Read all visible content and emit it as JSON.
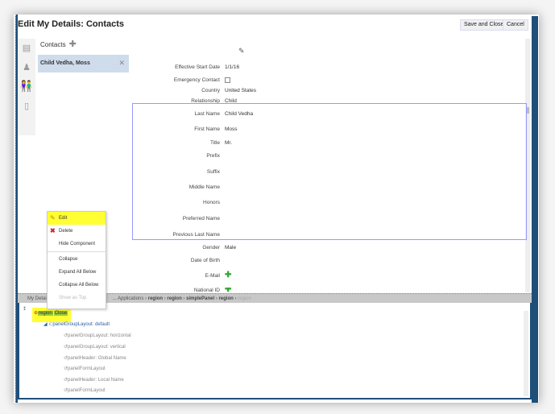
{
  "header": {
    "title": "Edit My Details: Contacts",
    "save_close": "Save and Close",
    "cancel": "Cancel"
  },
  "contacts": {
    "heading": "Contacts",
    "add_icon": "plus-icon",
    "items": [
      {
        "name": "Child Vedha, Moss"
      }
    ]
  },
  "form": {
    "effective_start_date": {
      "label": "Effective Start Date",
      "value": "1/1/16"
    },
    "emergency_contact": {
      "label": "Emergency Contact"
    },
    "country": {
      "label": "Country",
      "value": "United States"
    },
    "relationship": {
      "label": "Relationship",
      "value": "Child"
    },
    "last_name": {
      "label": "Last Name",
      "value": "Child Vedha"
    },
    "first_name": {
      "label": "First Name",
      "value": "Moss"
    },
    "title": {
      "label": "Title",
      "value": "Mr."
    },
    "prefix": {
      "label": "Prefix"
    },
    "suffix": {
      "label": "Suffix"
    },
    "middle_name": {
      "label": "Middle Name"
    },
    "honors": {
      "label": "Honors"
    },
    "preferred_name": {
      "label": "Preferred Name"
    },
    "previous_last_name": {
      "label": "Previous Last Name"
    },
    "gender": {
      "label": "Gender",
      "value": "Male"
    },
    "dob": {
      "label": "Date of Birth"
    },
    "email": {
      "label": "E-Mail"
    },
    "national_id": {
      "label": "National ID"
    }
  },
  "context_menu": {
    "edit": "Edit",
    "delete": "Delete",
    "hide": "Hide Component",
    "collapse": "Collapse",
    "expand_all": "Expand All Below",
    "collapse_all": "Collapse All Below",
    "show_top": "Show as Top"
  },
  "breadcrumb": {
    "start": "My Details",
    "items": [
      "... Applications",
      "region",
      "region",
      "simplePanel",
      "region"
    ],
    "current": "region"
  },
  "tree": {
    "root": "region",
    "root_tag": "Close",
    "child": "panelGroupLayout: default",
    "items": [
      "panelGroupLayout: horizontal",
      "panelGroupLayout: vertical",
      "panelHeader: Global Name",
      "panelFormLayout",
      "panelHeader: Local Name",
      "panelFormLayout"
    ]
  }
}
